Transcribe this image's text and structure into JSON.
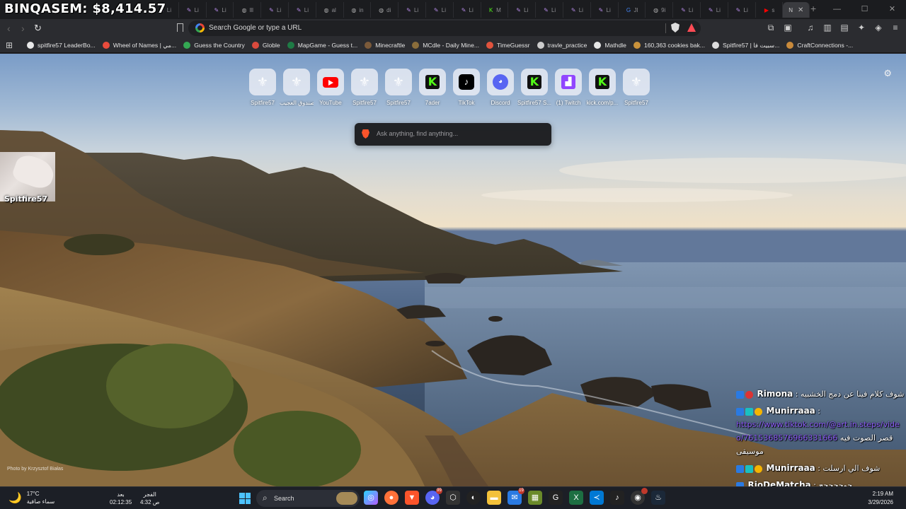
{
  "overlay": {
    "title": "BINQASEM: $8,414.57"
  },
  "tabs": [
    {
      "label": "Li",
      "icon": "feather-icon"
    },
    {
      "label": "Li",
      "icon": "feather-icon"
    },
    {
      "label": "Li",
      "icon": "feather-icon"
    },
    {
      "label": "lll",
      "icon": "globe-icon"
    },
    {
      "label": "Li",
      "icon": "feather-icon"
    },
    {
      "label": "Li",
      "icon": "feather-icon"
    },
    {
      "label": "al",
      "icon": "globe-icon"
    },
    {
      "label": "in",
      "icon": "globe-icon"
    },
    {
      "label": "di",
      "icon": "globe-icon"
    },
    {
      "label": "Li",
      "icon": "feather-icon"
    },
    {
      "label": "Li",
      "icon": "feather-icon"
    },
    {
      "label": "Li",
      "icon": "feather-icon"
    },
    {
      "label": "M",
      "icon": "kick-icon"
    },
    {
      "label": "Li",
      "icon": "feather-icon"
    },
    {
      "label": "Li",
      "icon": "feather-icon"
    },
    {
      "label": "Li",
      "icon": "feather-icon"
    },
    {
      "label": "Li",
      "icon": "feather-icon"
    },
    {
      "label": "Jl",
      "icon": "google-icon"
    },
    {
      "label": "9i",
      "icon": "globe-icon"
    },
    {
      "label": "Li",
      "icon": "feather-icon"
    },
    {
      "label": "Li",
      "icon": "feather-icon"
    },
    {
      "label": "Li",
      "icon": "feather-icon"
    },
    {
      "label": "s",
      "icon": "youtube-icon"
    }
  ],
  "active_tab": {
    "label": "N"
  },
  "address_bar": {
    "placeholder": "Search Google or type a URL"
  },
  "bookmarks": [
    {
      "label": "spitfire57 LeaderBo...",
      "color": "#e8e8e8"
    },
    {
      "label": "Wheel of Names | مي...",
      "color": "#e94b3c"
    },
    {
      "label": "Guess the Country",
      "color": "#34a853"
    },
    {
      "label": "Globle",
      "color": "#d94a3d"
    },
    {
      "label": "MapGame - Guess t...",
      "color": "#1e7b45"
    },
    {
      "label": "Minecraftle",
      "color": "#7b5a3a"
    },
    {
      "label": "MCdle - Daily Mine...",
      "color": "#8a6d3b"
    },
    {
      "label": "TimeGuessr",
      "color": "#e0533d"
    },
    {
      "label": "travle_practice",
      "color": "#cccccc"
    },
    {
      "label": "Mathdle",
      "color": "#e6e6e6"
    },
    {
      "label": "160,363 cookies bak...",
      "color": "#c9923b"
    },
    {
      "label": "Spitfire57 | سبيت فا...",
      "color": "#dddddd"
    },
    {
      "label": "CraftConnections -...",
      "color": "#c98a3b"
    }
  ],
  "top_sites": [
    {
      "label": "Spitfire57",
      "icon": "spitfire-icon"
    },
    {
      "label": "صندوق العجيب",
      "icon": "spitfire-icon"
    },
    {
      "label": "YouTube",
      "icon": "youtube-icon"
    },
    {
      "label": "Spitfire57",
      "icon": "spitfire-icon"
    },
    {
      "label": "Spitfire57",
      "icon": "spitfire-icon"
    },
    {
      "label": "7ader",
      "icon": "kick-icon"
    },
    {
      "label": "TikTok",
      "icon": "tiktok-icon"
    },
    {
      "label": "Discord",
      "icon": "discord-icon"
    },
    {
      "label": "Spitfire57 S...",
      "icon": "kick-icon"
    },
    {
      "label": "(1) Twitch",
      "icon": "twitch-icon"
    },
    {
      "label": "kick.com/p...",
      "icon": "kick-icon"
    },
    {
      "label": "Spitfire57",
      "icon": "spitfire-icon"
    }
  ],
  "ntp": {
    "search_placeholder": "Ask anything, find anything...",
    "photo_credit": "Photo by Krzysztof Białas",
    "webcam_name": "Spitfire57"
  },
  "chat": [
    {
      "user": "Rimona",
      "text": "شوف كلام فينا عن دمج الخشبيه"
    },
    {
      "user": "Munirraaa",
      "link": "https://www.tiktok.com/@art.in.steps/video/7615368576966331666",
      "text": "قصر الصوت فيه موسيقى"
    },
    {
      "user": "Munirraaa",
      "text": "شوف الي ارسلت"
    },
    {
      "user": "RioDeMatcha",
      "text": "جوججججج"
    }
  ],
  "taskbar": {
    "weather_temp": "17°C",
    "weather_desc": "سماء صافية",
    "prayer1_name": "بعد",
    "prayer1_time": "02:12:35",
    "prayer2_name": "الفجر",
    "prayer2_time": "4:32 ص",
    "search_label": "Search",
    "clock_time": "2:19 AM",
    "clock_date": "3/29/2026"
  }
}
